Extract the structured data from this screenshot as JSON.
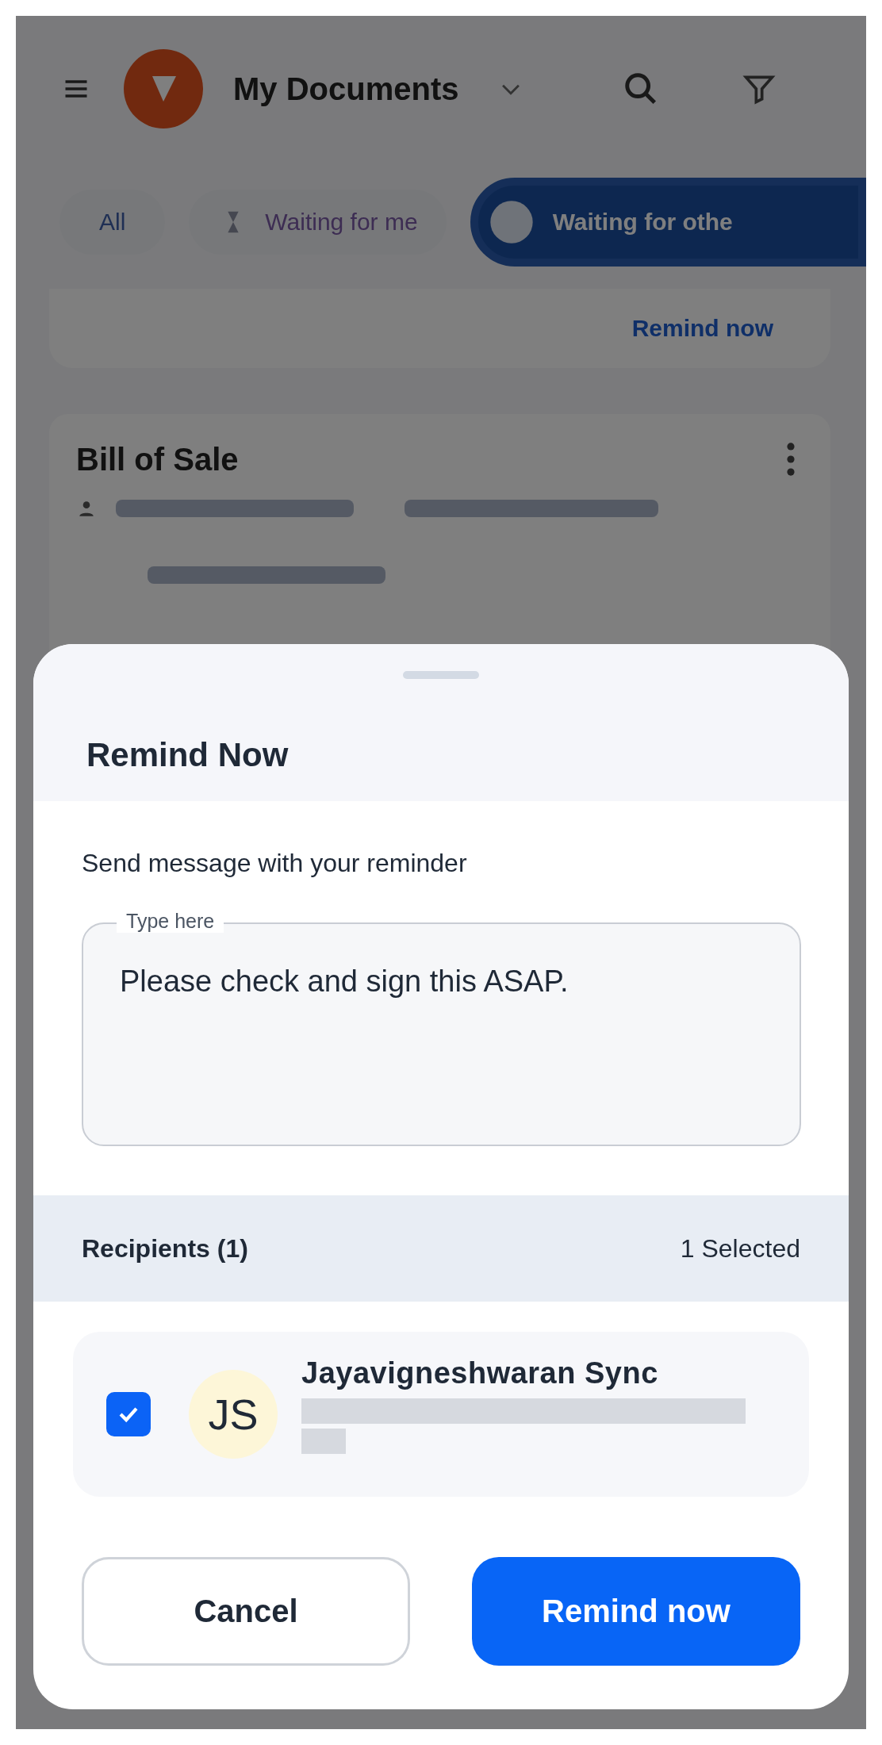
{
  "background": {
    "header": {
      "title": "My Documents"
    },
    "filters": [
      {
        "label": "All",
        "selected": false
      },
      {
        "label": "Waiting for me",
        "selected": false
      },
      {
        "label": "Waiting for othe",
        "selected": true
      }
    ],
    "reminder_card": {
      "link": "Remind now"
    },
    "document": {
      "title": "Bill of Sale"
    }
  },
  "sheet": {
    "title": "Remind Now",
    "message_label": "Send message with your reminder",
    "message_field": {
      "label": "Type here",
      "value": "Please check and sign this ASAP."
    },
    "recipients_header": {
      "title": "Recipients (1)",
      "count": "1 Selected"
    },
    "recipients": [
      {
        "initials": "JS",
        "name": "Jayavigneshwaran Sync",
        "checked": true
      }
    ],
    "buttons": [
      {
        "label": "Cancel",
        "kind": "secondary"
      },
      {
        "label": "Remind now",
        "kind": "primary"
      }
    ]
  }
}
